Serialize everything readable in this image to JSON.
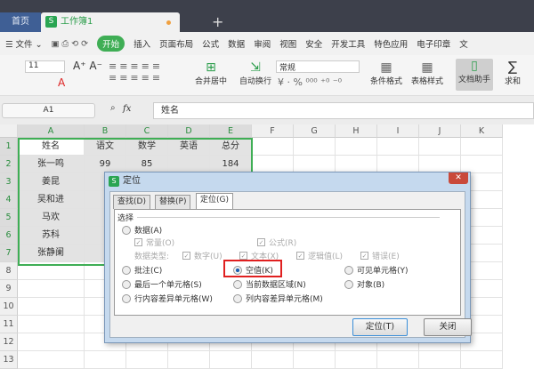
{
  "tabs": {
    "home": "首页",
    "workbook": "工作簿1",
    "new": "+",
    "s": "S"
  },
  "menu": {
    "file": "文件",
    "items": [
      "开始",
      "插入",
      "页面布局",
      "公式",
      "数据",
      "审阅",
      "视图",
      "安全",
      "开发工具",
      "特色应用",
      "电子印章",
      "文"
    ]
  },
  "ribbon": {
    "font_size": "11",
    "number_format": "常规",
    "merge": "合并居中",
    "wrap": "自动换行",
    "cond_format": "条件格式",
    "table_style": "表格样式",
    "doc_helper": "文档助手",
    "sum": "求和",
    "sigma": "∑"
  },
  "formula": {
    "cell_ref": "A1",
    "fx": "fx",
    "value": "姓名"
  },
  "columns": [
    "A",
    "B",
    "C",
    "D",
    "E",
    "F",
    "G",
    "H",
    "I",
    "J",
    "K"
  ],
  "rows": [
    "1",
    "2",
    "3",
    "4",
    "5",
    "6",
    "7",
    "8",
    "9",
    "10",
    "11",
    "12",
    "13"
  ],
  "cells": [
    [
      "姓名",
      "语文",
      "数学",
      "英语",
      "总分"
    ],
    [
      "张一鸣",
      "99",
      "85",
      "",
      "184"
    ],
    [
      "姜昆",
      "",
      "",
      "",
      ""
    ],
    [
      "吴和进",
      "",
      "",
      "",
      ""
    ],
    [
      "马欢",
      "",
      "",
      "",
      ""
    ],
    [
      "苏科",
      "",
      "",
      "",
      ""
    ],
    [
      "张静阑",
      "",
      "",
      "",
      ""
    ]
  ],
  "dialog": {
    "title": "定位",
    "close": "✕",
    "tabs": [
      "查找(D)",
      "替换(P)",
      "定位(G)"
    ],
    "group": "选择",
    "data": "数据(A)",
    "constant": "常量(O)",
    "formula": "公式(R)",
    "data_type": "数据类型:",
    "number": "数字(U)",
    "text": "文本(X)",
    "logical": "逻辑值(L)",
    "error": "错误(E)",
    "comment": "批注(C)",
    "blank": "空值(K)",
    "visible": "可见单元格(Y)",
    "last_cell": "最后一个单元格(S)",
    "current_region": "当前数据区域(N)",
    "object": "对象(B)",
    "row_diff": "行内容差异单元格(W)",
    "col_diff": "列内容差异单元格(M)",
    "locate_btn": "定位(T)",
    "close_btn": "关闭",
    "check": "✓"
  }
}
